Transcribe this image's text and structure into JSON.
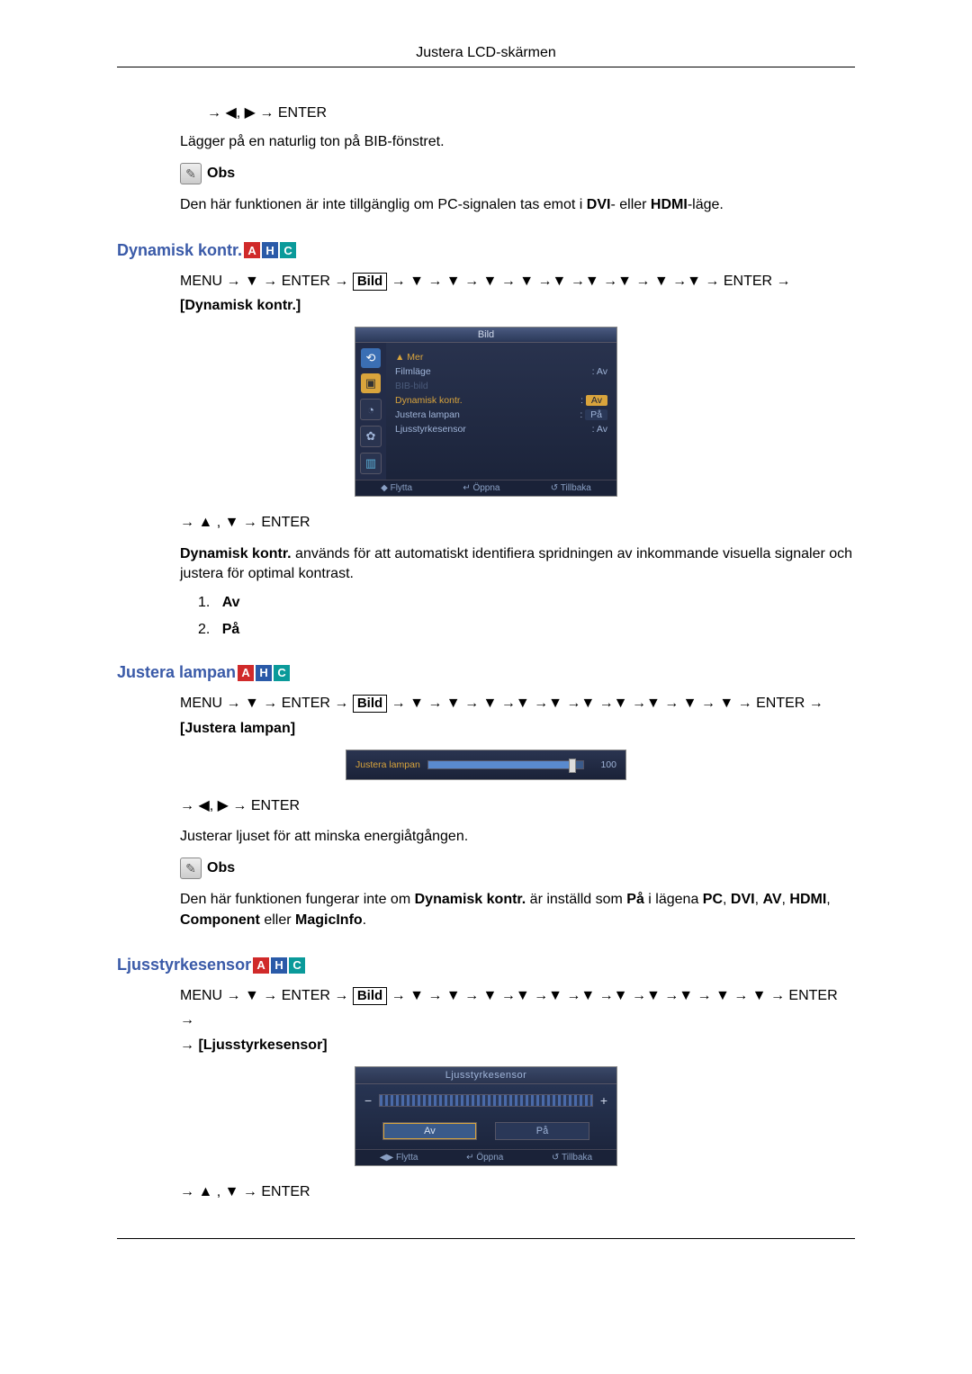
{
  "header": {
    "title": "Justera LCD-skärmen"
  },
  "top": {
    "arrow_nav": "→ ◀, ▶ → ENTER",
    "desc": "Lägger på en naturlig ton på BIB-fönstret.",
    "note_label": "Obs",
    "note_text_pre": "Den här funktionen är inte tillgänglig om PC-signalen tas emot i ",
    "note_b1": "DVI",
    "note_mid": "- eller ",
    "note_b2": "HDMI",
    "note_post": "-läge."
  },
  "dynamisk": {
    "title": "Dynamisk kontr.",
    "menu_pre": "MENU → ▼ → ENTER → ",
    "bild": "Bild",
    "menu_mid": " → ▼ → ▼ → ▼ → ▼ →▼ →▼ →▼ → ▼ →▼ → ENTER → ",
    "menu_target": "[Dynamisk kontr.]",
    "nav2": "→ ▲ , ▼ → ENTER",
    "desc_b": "Dynamisk kontr.",
    "desc_rest": " används för att automatiskt identifiera spridningen av inkommande visuella signaler och justera för optimal kontrast.",
    "li1_num": "1.",
    "li1": "Av",
    "li2_num": "2.",
    "li2": "På"
  },
  "osd1": {
    "title": "Bild",
    "mer": "▲ Mer",
    "rows": [
      {
        "label": "Filmläge",
        "value": "Av"
      },
      {
        "label": "BIB-bild",
        "value": ""
      },
      {
        "label": "Dynamisk kontr.",
        "value": "Av"
      },
      {
        "label": "Justera lampan",
        "value": "På"
      },
      {
        "label": "Ljusstyrkesensor",
        "value": "Av"
      }
    ],
    "footer": {
      "move": "◆ Flytta",
      "open": "↵ Öppna",
      "back": "↺ Tillbaka"
    }
  },
  "lampan": {
    "title": "Justera lampan",
    "menu_pre": "MENU → ▼ → ENTER → ",
    "bild": "Bild",
    "menu_mid": " → ▼ → ▼ → ▼ →▼ →▼ →▼ →▼ →▼ → ▼ → ▼ → ENTER → ",
    "menu_target": "[Justera lampan]",
    "slider_label": "Justera lampan",
    "slider_value": "100",
    "nav": "→ ◀, ▶ → ENTER",
    "desc": "Justerar ljuset för att minska energiåtgången.",
    "note_label": "Obs",
    "note_pre": "Den här funktionen fungerar inte om ",
    "note_b1": "Dynamisk kontr.",
    "note_mid1": " är inställd som ",
    "note_b2": "På",
    "note_mid2": " i lägena ",
    "note_b3": "PC",
    "comma1": ", ",
    "note_b4": "DVI",
    "comma2": ", ",
    "note_b5": "AV",
    "comma3": ", ",
    "note_b6": "HDMI",
    "comma4": ", ",
    "note_b7": "Component",
    "note_or": " eller ",
    "note_b8": "MagicInfo",
    "period": "."
  },
  "sensor": {
    "title": "Ljusstyrkesensor",
    "menu_pre": "MENU → ▼ → ENTER → ",
    "bild": "Bild",
    "menu_mid": " → ▼ → ▼ → ▼ →▼ →▼ →▼ →▼ →▼ →▼ → ▼ → ▼ → ENTER → ",
    "menu_target": "[Ljusstyrkesensor]",
    "osd_title": "Ljusstyrkesensor",
    "btn_av": "Av",
    "btn_pa": "På",
    "footer": {
      "move": "◀▶ Flytta",
      "open": "↵ Öppna",
      "back": "↺ Tillbaka"
    },
    "nav": "→ ▲ , ▼ → ENTER"
  }
}
